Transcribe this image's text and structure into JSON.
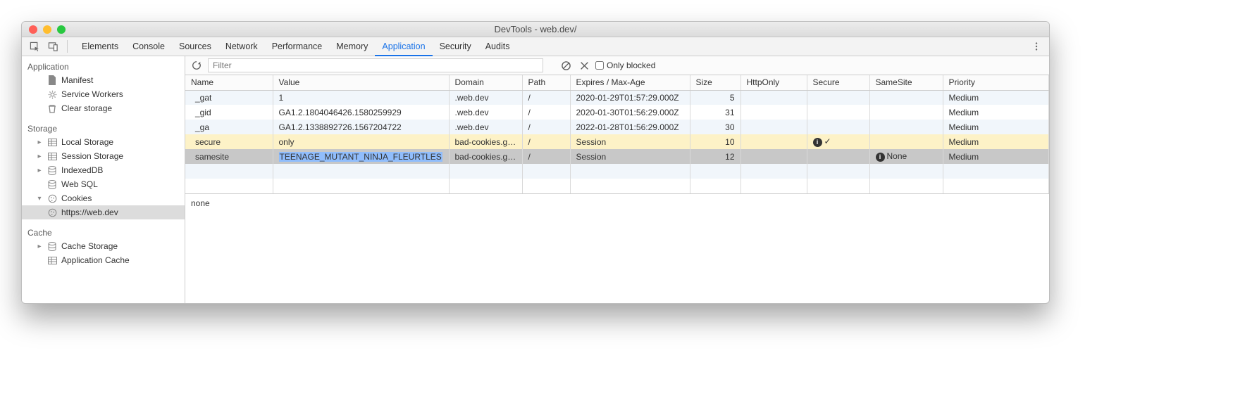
{
  "window": {
    "title": "DevTools - web.dev/"
  },
  "tabs": {
    "items": [
      "Elements",
      "Console",
      "Sources",
      "Network",
      "Performance",
      "Memory",
      "Application",
      "Security",
      "Audits"
    ],
    "active": "Application"
  },
  "sidebar": {
    "sections": [
      {
        "title": "Application",
        "items": [
          {
            "label": "Manifest",
            "icon": "document",
            "caret": ""
          },
          {
            "label": "Service Workers",
            "icon": "gear",
            "caret": ""
          },
          {
            "label": "Clear storage",
            "icon": "trash",
            "caret": ""
          }
        ]
      },
      {
        "title": "Storage",
        "items": [
          {
            "label": "Local Storage",
            "icon": "table",
            "caret": "▸"
          },
          {
            "label": "Session Storage",
            "icon": "table",
            "caret": "▸"
          },
          {
            "label": "IndexedDB",
            "icon": "db",
            "caret": "▸"
          },
          {
            "label": "Web SQL",
            "icon": "db",
            "caret": ""
          },
          {
            "label": "Cookies",
            "icon": "cookie",
            "caret": "▾",
            "children": [
              {
                "label": "https://web.dev",
                "icon": "cookie",
                "active": true
              }
            ]
          }
        ]
      },
      {
        "title": "Cache",
        "items": [
          {
            "label": "Cache Storage",
            "icon": "db",
            "caret": "▸"
          },
          {
            "label": "Application Cache",
            "icon": "table",
            "caret": ""
          }
        ]
      }
    ]
  },
  "toolbar": {
    "filter_placeholder": "Filter",
    "only_blocked": "Only blocked"
  },
  "columns": [
    "Name",
    "Value",
    "Domain",
    "Path",
    "Expires / Max-Age",
    "Size",
    "HttpOnly",
    "Secure",
    "SameSite",
    "Priority"
  ],
  "rows": [
    {
      "name": "_gat",
      "value": "1",
      "domain": ".web.dev",
      "path": "/",
      "expires": "2020-01-29T01:57:29.000Z",
      "size": "5",
      "httponly": "",
      "secure": "",
      "samesite": "",
      "priority": "Medium",
      "state": "zebra"
    },
    {
      "name": "_gid",
      "value": "GA1.2.1804046426.1580259929",
      "domain": ".web.dev",
      "path": "/",
      "expires": "2020-01-30T01:56:29.000Z",
      "size": "31",
      "httponly": "",
      "secure": "",
      "samesite": "",
      "priority": "Medium",
      "state": ""
    },
    {
      "name": "_ga",
      "value": "GA1.2.1338892726.1567204722",
      "domain": ".web.dev",
      "path": "/",
      "expires": "2022-01-28T01:56:29.000Z",
      "size": "30",
      "httponly": "",
      "secure": "",
      "samesite": "",
      "priority": "Medium",
      "state": "zebra"
    },
    {
      "name": "secure",
      "value": "only",
      "domain": "bad-cookies.g…",
      "path": "/",
      "expires": "Session",
      "size": "10",
      "httponly": "",
      "secure": "ⓘ ✓",
      "samesite": "",
      "priority": "Medium",
      "state": "warn"
    },
    {
      "name": "samesite",
      "value": "TEENAGE_MUTANT_NINJA_FLEURTLES",
      "domain": "bad-cookies.g…",
      "path": "/",
      "expires": "Session",
      "size": "12",
      "httponly": "",
      "secure": "",
      "samesite": "ⓘ None",
      "priority": "Medium",
      "state": "sel"
    }
  ],
  "empty_rows": 2,
  "detail": "none"
}
